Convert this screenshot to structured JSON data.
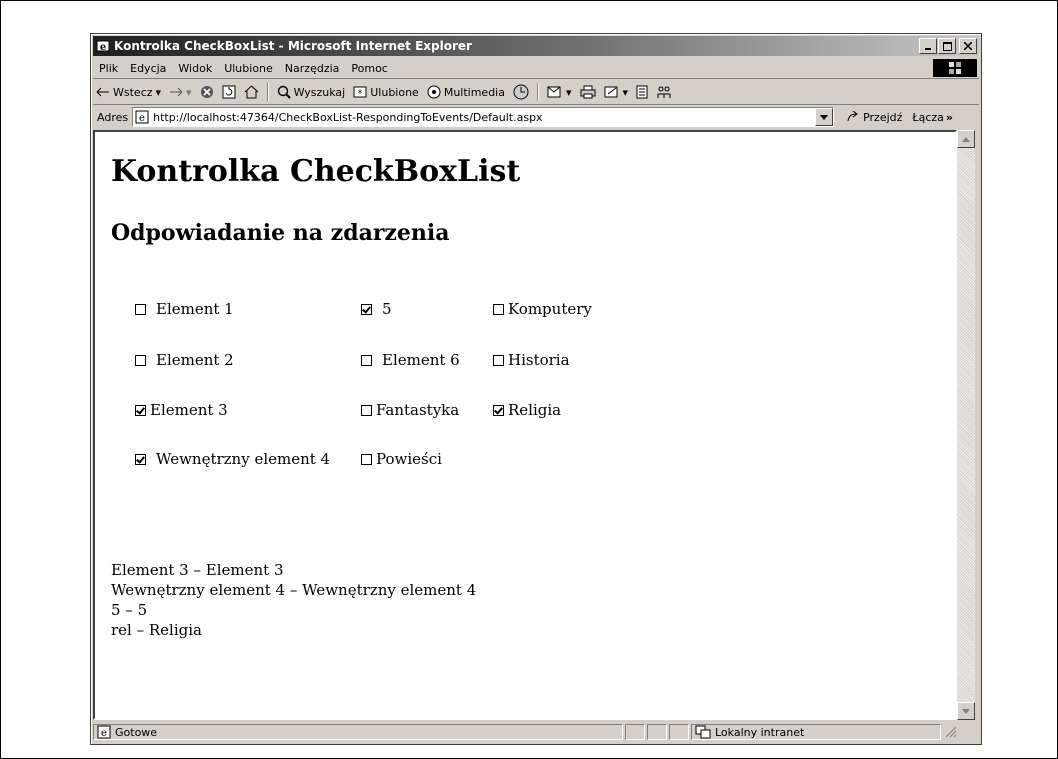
{
  "window": {
    "title": "Kontrolka CheckBoxList - Microsoft Internet Explorer"
  },
  "menu": [
    "Plik",
    "Edycja",
    "Widok",
    "Ulubione",
    "Narzędzia",
    "Pomoc"
  ],
  "toolbar": {
    "back": "Wstecz",
    "search": "Wyszukaj",
    "favorites": "Ulubione",
    "multimedia": "Multimedia"
  },
  "address": {
    "label": "Adres",
    "url": "http://localhost:47364/CheckBoxList-RespondingToEvents/Default.aspx",
    "go": "Przejdź",
    "links": "Łącza"
  },
  "page": {
    "title": "Kontrolka CheckBoxList",
    "subtitle": "Odpowiadanie na zdarzenia",
    "checkboxes": [
      {
        "label": "Element 1",
        "checked": false
      },
      {
        "label": "Element 2",
        "checked": false
      },
      {
        "label": "Element 3",
        "checked": true
      },
      {
        "label": "Wewnętrzny element 4",
        "checked": true
      },
      {
        "label": "5",
        "checked": true
      },
      {
        "label": "Element 6",
        "checked": false
      },
      {
        "label": "Fantastyka",
        "checked": false
      },
      {
        "label": "Powieści",
        "checked": false
      },
      {
        "label": "Komputery",
        "checked": false
      },
      {
        "label": "Historia",
        "checked": false
      },
      {
        "label": "Religia",
        "checked": true
      }
    ],
    "results": [
      "Element 3 – Element 3",
      "Wewnętrzny element 4 – Wewnętrzny element 4",
      "5 – 5",
      "rel – Religia"
    ]
  },
  "status": {
    "text": "Gotowe",
    "zone": "Lokalny intranet"
  }
}
